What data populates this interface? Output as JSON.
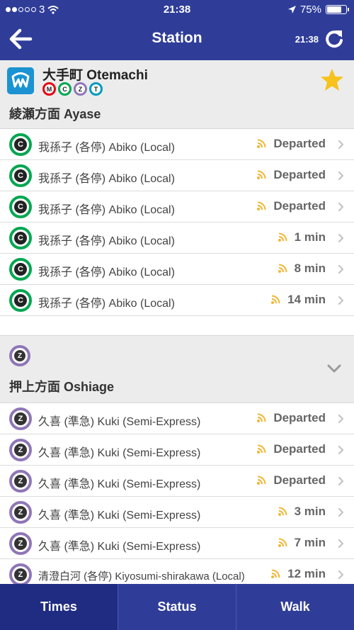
{
  "status_bar": {
    "carrier": "3",
    "time": "21:38",
    "battery": "75%",
    "battery_level": 0.75,
    "signal_dots_filled": 2,
    "signal_dots_total": 5
  },
  "nav": {
    "title": "Station",
    "updated_time": "21:38",
    "back_icon": "arrow-left-icon",
    "refresh_icon": "refresh-icon"
  },
  "colors": {
    "brand": "#2f3d99",
    "chiyoda": "#00a650",
    "hanzomon": "#8f76b7",
    "marunouchi": "#e60012",
    "tozai": "#009bbf",
    "signal": "#f2b632",
    "star": "#f6c21c"
  },
  "station": {
    "name": "大手町 Otemachi",
    "lines": [
      {
        "letter": "M",
        "color": "#e60012"
      },
      {
        "letter": "C",
        "color": "#00a650"
      },
      {
        "letter": "Z",
        "color": "#8f76b7"
      },
      {
        "letter": "T",
        "color": "#009bbf"
      }
    ],
    "favorite_icon": "star-icon"
  },
  "sections": [
    {
      "direction": "綾瀬方面 Ayase",
      "line_letter": "C",
      "departures": [
        {
          "destination": "我孫子 (各停) Abiko (Local)",
          "eta": "Departed"
        },
        {
          "destination": "我孫子 (各停) Abiko (Local)",
          "eta": "Departed"
        },
        {
          "destination": "我孫子 (各停) Abiko (Local)",
          "eta": "Departed"
        },
        {
          "destination": "我孫子 (各停) Abiko (Local)",
          "eta": "1 min"
        },
        {
          "destination": "我孫子 (各停) Abiko (Local)",
          "eta": "8 min"
        },
        {
          "destination": "我孫子 (各停) Abiko (Local)",
          "eta": "14 min"
        }
      ]
    },
    {
      "direction": "押上方面 Oshiage",
      "line_letter": "Z",
      "departures": [
        {
          "destination": "久喜 (準急) Kuki (Semi-Express)",
          "eta": "Departed"
        },
        {
          "destination": "久喜 (準急) Kuki (Semi-Express)",
          "eta": "Departed"
        },
        {
          "destination": "久喜 (準急) Kuki (Semi-Express)",
          "eta": "Departed"
        },
        {
          "destination": "久喜 (準急) Kuki (Semi-Express)",
          "eta": "3 min"
        },
        {
          "destination": "久喜 (準急) Kuki (Semi-Express)",
          "eta": "7 min"
        },
        {
          "destination": "清澄白河 (各停) Kiyosumi-shirakawa (Local)",
          "eta": "12 min"
        }
      ]
    }
  ],
  "tabs": [
    {
      "label": "Times",
      "active": true
    },
    {
      "label": "Status",
      "active": false
    },
    {
      "label": "Walk",
      "active": false
    }
  ]
}
